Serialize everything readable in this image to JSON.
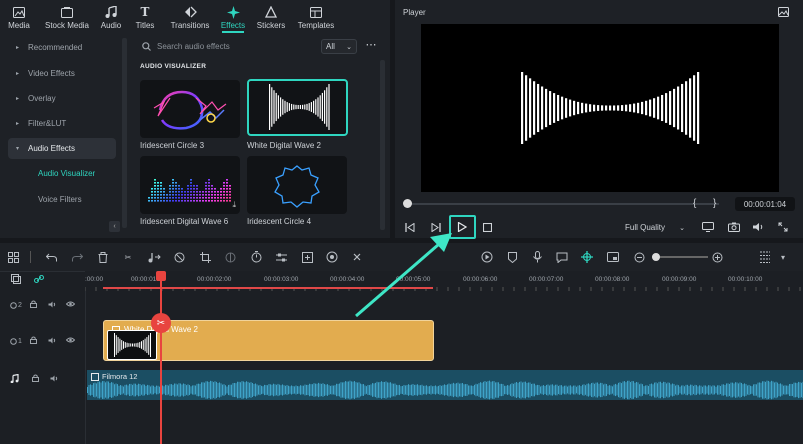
{
  "tabs": [
    {
      "label": "Media",
      "icon": "media-icon"
    },
    {
      "label": "Stock Media",
      "icon": "stock-media-icon"
    },
    {
      "label": "Audio",
      "icon": "music-note-icon"
    },
    {
      "label": "Titles",
      "icon": "text-icon"
    },
    {
      "label": "Transitions",
      "icon": "transition-icon"
    },
    {
      "label": "Effects",
      "icon": "effects-sparkle-icon",
      "active": true
    },
    {
      "label": "Stickers",
      "icon": "sticker-icon"
    },
    {
      "label": "Templates",
      "icon": "template-icon"
    }
  ],
  "sidebar": {
    "items": [
      {
        "label": "Recommended"
      },
      {
        "label": "Video Effects"
      },
      {
        "label": "Overlay"
      },
      {
        "label": "Filter&LUT"
      },
      {
        "label": "Audio Effects",
        "expanded": true
      }
    ],
    "subitems": [
      {
        "label": "Audio Visualizer",
        "active": true
      },
      {
        "label": "Voice Filters"
      }
    ]
  },
  "search": {
    "placeholder": "Search audio effects"
  },
  "filter": {
    "selected": "All"
  },
  "section_label": "AUDIO VISUALIZER",
  "effects": [
    {
      "label": "Iridescent Circle 3"
    },
    {
      "label": "White  Digital Wave 2",
      "selected": true
    },
    {
      "label": "Iridescent Digital Wave 6"
    },
    {
      "label": "Iridescent Circle 4"
    }
  ],
  "player": {
    "title": "Player",
    "timecode": "00:00:01:04",
    "quality": "Full Quality",
    "mark_in": "{",
    "mark_out": "}"
  },
  "ruler": {
    "ticks": [
      ":00:00",
      "00:00:01:00",
      "00:00:02:00",
      "00:00:03:00",
      "00:00:04:00",
      "00:00:05:00",
      "00:00:06:00",
      "00:00:07:00",
      "00:00:08:00",
      "00:00:09:00",
      "00:00:10:00"
    ]
  },
  "tracks": {
    "video2_num": "2",
    "video1_num": "1",
    "clip_label": "White  Digital Wave 2",
    "audio_clip_label": "Filmora 12"
  },
  "colors": {
    "accent": "#2fd6c0",
    "playhead": "#e8443f",
    "clip": "#e2ac4f",
    "audio": "#1b4e63"
  }
}
